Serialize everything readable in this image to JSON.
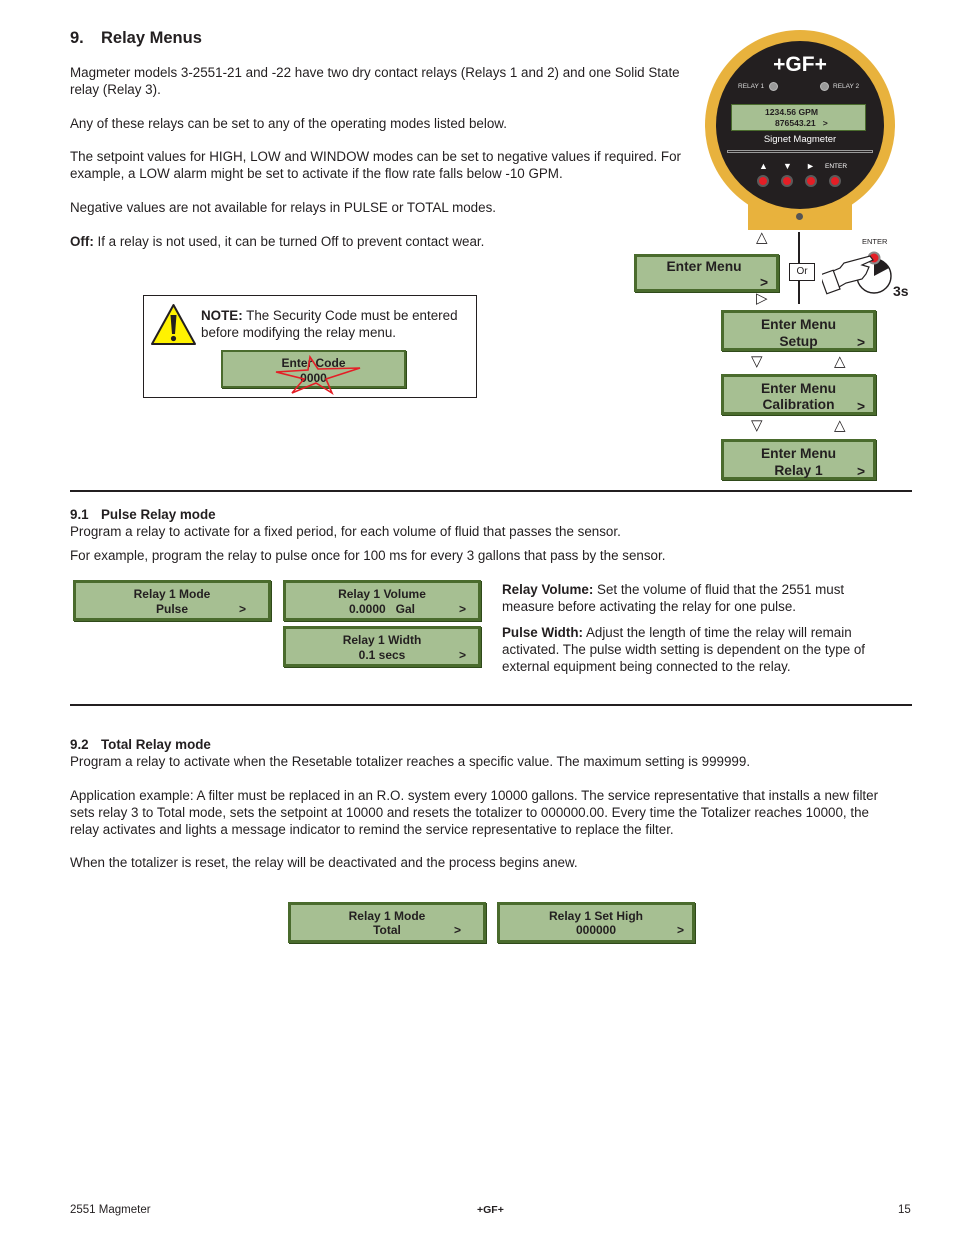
{
  "section": {
    "number": "9.",
    "title": "Relay Menus",
    "paragraphs": [
      "Magmeter models 3-2551-21 and -22 have two dry contact relays (Relays 1 and 2) and one Solid State relay (Relay 3).",
      "Any of these relays can be set to any of the operating modes listed below.",
      "The setpoint values for HIGH, LOW and WINDOW modes can be set to negative values if required. For example, a LOW alarm might be set to activate if the flow rate falls below -10 GPM.",
      "Negative values are not available for relays in PULSE or TOTAL modes."
    ],
    "off_label": "Off:",
    "off_text": " If a relay is not used, it can be turned Off to prevent contact wear."
  },
  "note": {
    "label": "NOTE:",
    "text": " The Security Code must be entered before modifying the relay menu.",
    "lcd": {
      "line1": "Enter Code",
      "line2": "0000"
    }
  },
  "meter": {
    "logo": "+GF+",
    "relay1_label": "RELAY 1",
    "relay2_label": "RELAY 2",
    "display_line1": "1234.56  GPM",
    "display_line2": "876543.21   >",
    "name": "Signet Magmeter",
    "keys": {
      "up": "▲",
      "down": "▼",
      "right": "►",
      "enter": "ENTER"
    }
  },
  "menu_flow": {
    "enter_menu": {
      "line1": "Enter Menu",
      "arrow": ">"
    },
    "or_label": "Or",
    "enter_key_label": "ENTER",
    "hold_time": "3s",
    "menus": [
      {
        "line1": "Enter Menu",
        "line2": "Setup",
        "arrow": ">"
      },
      {
        "line1": "Enter Menu",
        "line2": "Calibration",
        "arrow": ">"
      },
      {
        "line1": "Enter Menu",
        "line2": "Relay 1",
        "arrow": ">"
      }
    ]
  },
  "pulse": {
    "number": "9.1",
    "title": "Pulse Relay mode",
    "para1": "Program a relay to activate for a fixed period, for each volume of fluid that passes the sensor.",
    "para2": "For example, program the relay to pulse once for 100 ms for every 3 gallons that pass by the sensor.",
    "lcds": [
      {
        "line1": "Relay 1 Mode",
        "line2": "Pulse",
        "arrow": ">"
      },
      {
        "line1": "Relay 1 Volume",
        "line2": "0.0000   Gal",
        "arrow": ">"
      },
      {
        "line1": "Relay 1 Width",
        "line2": "0.1 secs",
        "arrow": ">"
      }
    ],
    "volume_label": "Relay Volume:",
    "volume_text": " Set the volume of fluid that the 2551 must measure before activating the relay for one pulse.",
    "width_label": "Pulse Width:",
    "width_text": " Adjust the length of time the relay will remain activated. The pulse width setting is dependent on the type of external equipment being connected to the relay."
  },
  "total": {
    "number": "9.2",
    "title": "Total Relay mode",
    "para1": "Program a relay to activate when the Resetable totalizer reaches a specific value. The maximum setting is 999999.",
    "para2": "Application example: A filter must be replaced in an R.O. system every 10000 gallons. The service representative that installs a new filter sets relay 3 to Total mode, sets the setpoint at 10000 and resets the totalizer to 000000.00. Every time the Totalizer reaches 10000, the relay activates and lights a message indicator to remind the service representative to replace the filter.",
    "para3": "When the totalizer is reset, the relay will be deactivated and the process begins anew.",
    "lcds": [
      {
        "line1": "Relay 1 Mode",
        "line2": "Total",
        "arrow": ">"
      },
      {
        "line1": "Relay 1 Set High",
        "line2": "000000",
        "arrow": ">"
      }
    ]
  },
  "footer": {
    "left": "2551 Magmeter",
    "center": "+GF+",
    "right": "15"
  }
}
